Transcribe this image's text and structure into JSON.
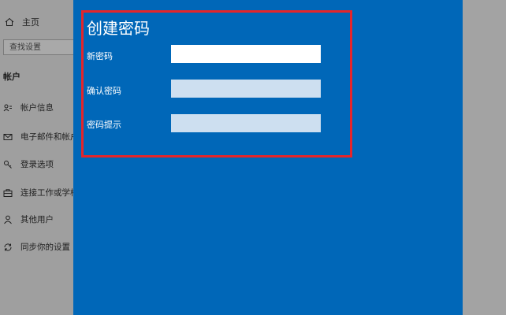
{
  "sidebar": {
    "home_label": "主页",
    "search_placeholder": "查找设置",
    "section_title": "帐户",
    "items": [
      {
        "label": "帐户信息",
        "icon": "person-card-icon"
      },
      {
        "label": "电子邮件和帐户",
        "icon": "mail-icon"
      },
      {
        "label": "登录选项",
        "icon": "key-icon"
      },
      {
        "label": "连接工作或学校",
        "icon": "briefcase-icon"
      },
      {
        "label": "其他用户",
        "icon": "person-icon"
      },
      {
        "label": "同步你的设置",
        "icon": "sync-icon"
      }
    ]
  },
  "dialog": {
    "title": "创建密码",
    "fields": [
      {
        "label": "新密码",
        "value": ""
      },
      {
        "label": "确认密码",
        "value": ""
      },
      {
        "label": "密码提示",
        "value": ""
      }
    ]
  },
  "colors": {
    "dialog_bg": "#0067b8",
    "highlight_border": "#e5252a"
  }
}
